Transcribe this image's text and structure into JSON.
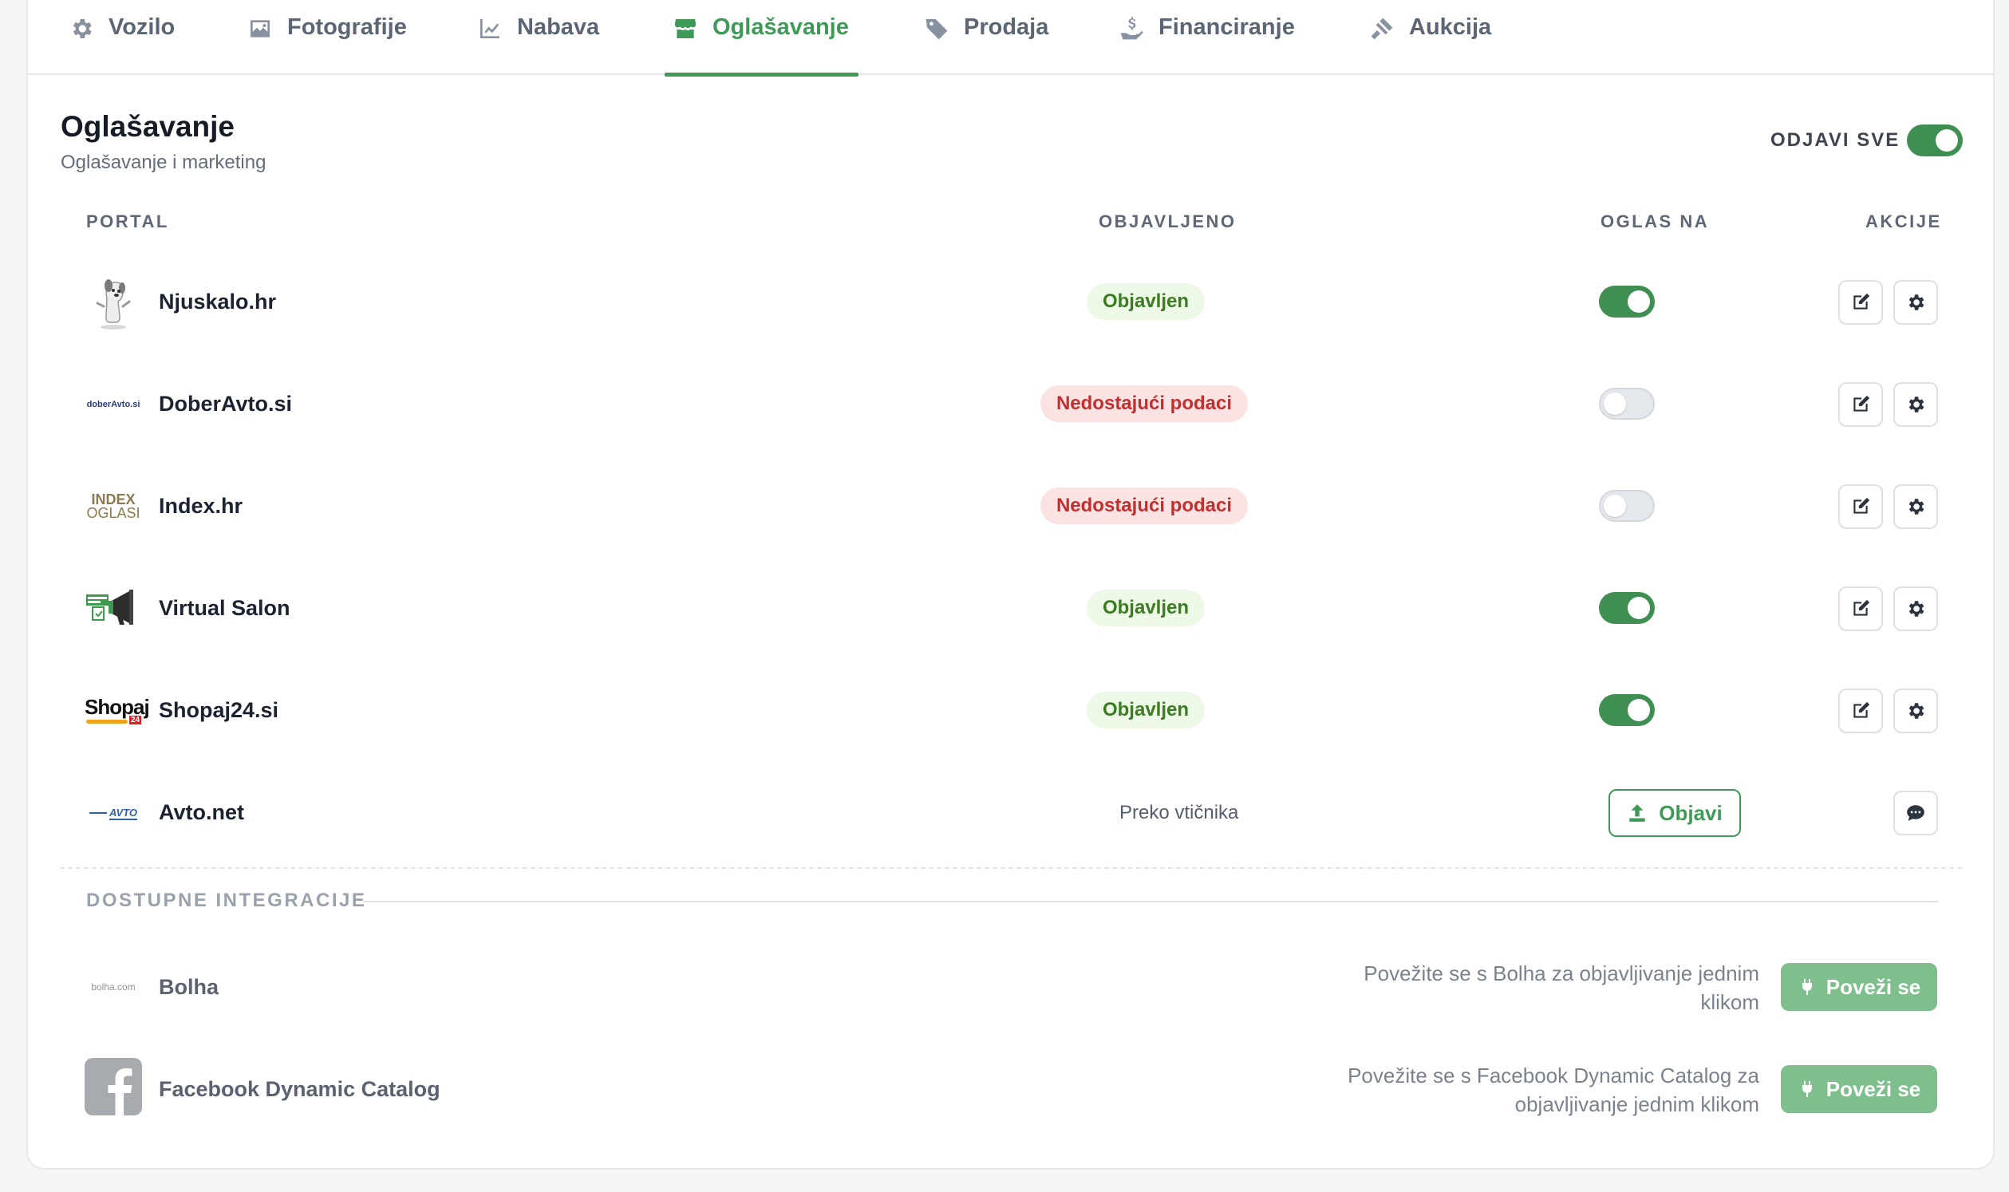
{
  "tabs": [
    {
      "label": "Vozilo",
      "icon": "gear-icon"
    },
    {
      "label": "Fotografije",
      "icon": "image-icon"
    },
    {
      "label": "Nabava",
      "icon": "chart-line-icon"
    },
    {
      "label": "Oglašavanje",
      "icon": "store-icon",
      "active": true
    },
    {
      "label": "Prodaja",
      "icon": "tag-icon"
    },
    {
      "label": "Financiranje",
      "icon": "hand-coin-icon"
    },
    {
      "label": "Aukcija",
      "icon": "gavel-icon"
    }
  ],
  "header": {
    "title": "Oglašavanje",
    "subtitle": "Oglašavanje i marketing",
    "unpublish_all_label": "ODJAVI SVE",
    "unpublish_all_on": true
  },
  "table": {
    "columns": [
      "PORTAL",
      "OBJAVLJENO",
      "OGLAS NA",
      "AKCIJE"
    ],
    "rows": [
      {
        "name": "Njuskalo.hr",
        "status": "Objavljen",
        "status_type": "ok",
        "toggle_on": true
      },
      {
        "name": "DoberAvto.si",
        "status": "Nedostajući podaci",
        "status_type": "missing",
        "toggle_on": false
      },
      {
        "name": "Index.hr",
        "status": "Nedostajući podaci",
        "status_type": "missing",
        "toggle_on": false
      },
      {
        "name": "Virtual Salon",
        "status": "Objavljen",
        "status_type": "ok",
        "toggle_on": true
      },
      {
        "name": "Shopaj24.si",
        "status": "Objavljen",
        "status_type": "ok",
        "toggle_on": true
      },
      {
        "name": "Avto.net",
        "status": "Preko vtičnika",
        "status_type": "plugin",
        "publish_label": "Objavi"
      }
    ]
  },
  "logos": {
    "doberavto": "doberAvto.si",
    "index_line1": "INDEX",
    "index_line2": "OGLASI",
    "shopaj": "Shopaj",
    "shopaj_sub": "24",
    "avto": "AVTO",
    "bolha": "bolha.com"
  },
  "integrations": {
    "heading": "DOSTUPNE INTEGRACIJE",
    "items": [
      {
        "name": "Bolha",
        "description": "Povežite se s Bolha za objavljivanje jednim klikom",
        "button": "Poveži se"
      },
      {
        "name": "Facebook Dynamic Catalog",
        "description": "Povežite se s Facebook Dynamic Catalog za objavljivanje jednim klikom",
        "button": "Poveži se"
      }
    ]
  },
  "colors": {
    "accent": "#3f9a57",
    "ok_badge_bg": "#eef8e6",
    "missing_badge_bg": "#fbe3e3",
    "connect_button": "#7fbf8d"
  }
}
